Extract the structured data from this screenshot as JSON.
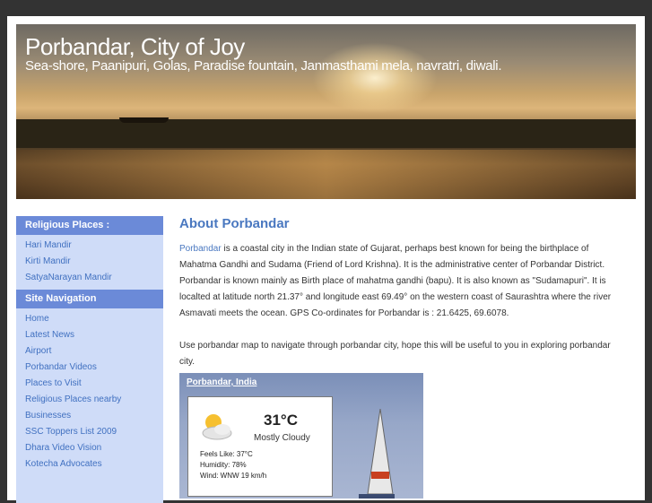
{
  "header": {
    "title": "Porbandar, City of Joy",
    "tagline": "Sea-shore, Paanipuri, Golas, Paradise fountain, Janmasthami mela, navratri, diwali."
  },
  "sidebar": {
    "sections": [
      {
        "heading": "Religious Places :",
        "items": [
          "Hari Mandir",
          "Kirti Mandir",
          "SatyaNarayan Mandir"
        ]
      },
      {
        "heading": "Site Navigation",
        "items": [
          "Home",
          "Latest News",
          "Airport",
          "Porbandar Videos",
          "Places to Visit",
          "Religious Places nearby",
          "Businesses",
          "SSC Toppers List 2009",
          "Dhara Video Vision",
          "Kotecha Advocates"
        ]
      }
    ]
  },
  "main": {
    "title": "About Porbandar",
    "intro_link": "Porbandar",
    "intro_text": " is a coastal city in the Indian state of Gujarat, perhaps best known for being the birthplace of Mahatma Gandhi and Sudama (Friend of Lord Krishna). It is the administrative center of Porbandar District. Porbandar is known mainly as Birth place of mahatma gandhi (bapu). It is also known as \"Sudamapuri\". It is localted at latitude north 21.37° and longitude east 69.49° on the western coast of Saurashtra where the river Asmavati meets the ocean. GPS Co-ordinates for Porbandar is : 21.6425, 69.6078.",
    "map_text": "Use porbandar map to navigate through porbandar city, hope this will be useful to you in exploring porbandar city."
  },
  "weather": {
    "location": "Porbandar, India",
    "temperature": "31°C",
    "condition": "Mostly Cloudy",
    "feels_like": "Feels Like: 37°C",
    "humidity": "Humidity: 78%",
    "wind": "Wind: WNW 19 km/h",
    "icon": "partly-cloudy-icon"
  },
  "colors": {
    "background": "#333333",
    "sidebar_bg": "#cfdcf8",
    "sidebar_heading_bg": "#6b8ad8",
    "link": "#4070c0",
    "title": "#4a78c0"
  }
}
